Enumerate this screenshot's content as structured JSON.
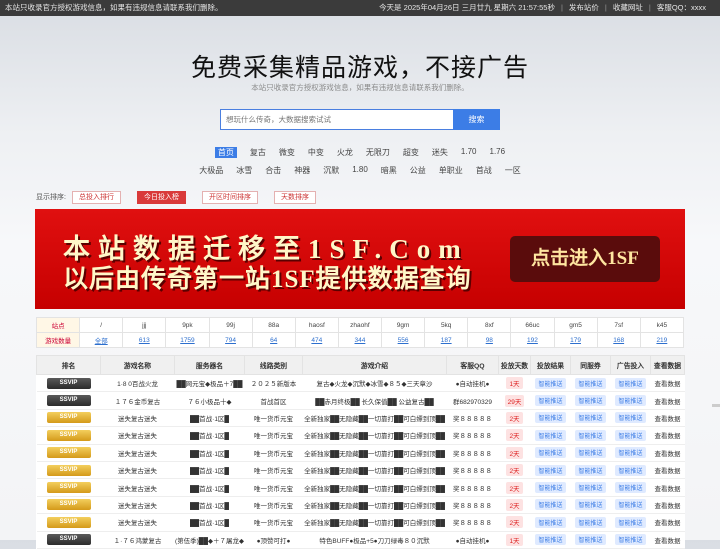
{
  "topbar": {
    "notice": "本站只收录官方授权游戏信息，如果有违规信息请联系我们删除。",
    "date": "今天是 2025年04月26日 三月廿九 星期六 21:57:55秒",
    "publish": "发布站价",
    "favorite": "收藏网址",
    "qq": "客服QQ：xxxx"
  },
  "hero": {
    "title": "免费采集精品游戏，不接广告",
    "subtitle": "本站只收录官方授权游戏信息，如果有违规信息请联系我们删除。"
  },
  "search": {
    "placeholder": "想玩什么传奇，大数据搜索试试",
    "button": "搜索"
  },
  "nav1": [
    "首页",
    "复古",
    "微变",
    "中变",
    "火龙",
    "无限刀",
    "超变",
    "迷失",
    "1.70",
    "1.76"
  ],
  "nav2": [
    "大极品",
    "冰雪",
    "合击",
    "神器",
    "沉默",
    "1.80",
    "暗黑",
    "公益",
    "单职业",
    "首战",
    "一区"
  ],
  "sort": {
    "label": "显示排序:",
    "buttons": [
      "总投入排行",
      "今日投入榜",
      "开区时间排序",
      "天数排序"
    ],
    "active": 1
  },
  "banner": {
    "line1": "本站数据迁移至1SF.Com",
    "line2": "以后由传奇第一站1SF提供数据查询",
    "cta": "点击进入1SF",
    "bg": "#d40000"
  },
  "stats": {
    "row1": [
      "站点",
      "/",
      "jjj",
      "9pk",
      "99j",
      "88a",
      "haosf",
      "zhaohf",
      "9gm",
      "5kq",
      "8xf",
      "66uc",
      "gm5",
      "7sf",
      "k45"
    ],
    "row2": [
      "游戏数量",
      "全部",
      "613",
      "1759",
      "794",
      "64",
      "474",
      "344",
      "556",
      "187",
      "98",
      "192",
      "179",
      "168",
      "219"
    ]
  },
  "table": {
    "headers": [
      "排名",
      "游戏名称",
      "服务器名",
      "线路类别",
      "游戏介绍",
      "客服QQ",
      "投放天数",
      "投放结果",
      "同服券",
      "广告投入",
      "查看数据"
    ],
    "rows": [
      {
        "rank": "SSVIP",
        "style": "dark",
        "name": "1·8 0百战火龙",
        "server": "██网元宝◆极品＋7██",
        "line": "２０２５新版本",
        "intro": "复古◆火龙◆沉默◆冰雪◆８５◆三天章沙",
        "qq": "●自动挂机●",
        "days": "1天",
        "r1": "智能推送",
        "r2": "智能推送",
        "r3": "智能推送",
        "view": "查看数据"
      },
      {
        "rank": "SSVIP",
        "style": "dark",
        "name": "１７６金币复古",
        "server": "７６小极品十◆",
        "line": "首战首区",
        "intro": "██赤月终极██ 长久保值██ 公益复古██",
        "qq": "群682970329",
        "days": "29天",
        "r1": "智能推送",
        "r2": "智能推送",
        "r3": "智能推送",
        "view": "查看数据"
      },
      {
        "rank": "SSVIP",
        "style": "gold",
        "name": "迷失复古迷失",
        "server": "██首战·1区█",
        "line": "唯一货币元宝",
        "intro": "全新独家██无隐藏██一切靠打██可白嫖到顶██",
        "qq": "奖８８８８８",
        "days": "2天",
        "r1": "智能推送",
        "r2": "智能推送",
        "r3": "智能推送",
        "view": "查看数据"
      },
      {
        "rank": "SSVIP",
        "style": "gold",
        "name": "迷失复古迷失",
        "server": "██首战·1区█",
        "line": "唯一货币元宝",
        "intro": "全新独家██无隐藏██一切靠打██可白嫖到顶██",
        "qq": "奖８８８８８",
        "days": "2天",
        "r1": "智能推送",
        "r2": "智能推送",
        "r3": "智能推送",
        "view": "查看数据"
      },
      {
        "rank": "SSVIP",
        "style": "gold",
        "name": "迷失复古迷失",
        "server": "██首战·1区█",
        "line": "唯一货币元宝",
        "intro": "全新独家██无隐藏██一切靠打██可白嫖到顶██",
        "qq": "奖８８８８８",
        "days": "2天",
        "r1": "智能推送",
        "r2": "智能推送",
        "r3": "智能推送",
        "view": "查看数据"
      },
      {
        "rank": "SSVIP",
        "style": "gold",
        "name": "迷失复古迷失",
        "server": "██首战·1区█",
        "line": "唯一货币元宝",
        "intro": "全新独家██无隐藏██一切靠打██可白嫖到顶██",
        "qq": "奖８８８８８",
        "days": "2天",
        "r1": "智能推送",
        "r2": "智能推送",
        "r3": "智能推送",
        "view": "查看数据"
      },
      {
        "rank": "SSVIP",
        "style": "gold",
        "name": "迷失复古迷失",
        "server": "██首战·1区█",
        "line": "唯一货币元宝",
        "intro": "全新独家██无隐藏██一切靠打██可白嫖到顶██",
        "qq": "奖８８８８８",
        "days": "2天",
        "r1": "智能推送",
        "r2": "智能推送",
        "r3": "智能推送",
        "view": "查看数据"
      },
      {
        "rank": "SSVIP",
        "style": "gold",
        "name": "迷失复古迷失",
        "server": "██首战·1区█",
        "line": "唯一货币元宝",
        "intro": "全新独家██无隐藏██一切靠打██可白嫖到顶██",
        "qq": "奖８８８８８",
        "days": "2天",
        "r1": "智能推送",
        "r2": "智能推送",
        "r3": "智能推送",
        "view": "查看数据"
      },
      {
        "rank": "SSVIP",
        "style": "gold",
        "name": "迷失复古迷失",
        "server": "██首战·1区█",
        "line": "唯一货币元宝",
        "intro": "全新独家██无隐藏██一切靠打██可白嫖到顶██",
        "qq": "奖８８８８８",
        "days": "2天",
        "r1": "智能推送",
        "r2": "智能推送",
        "r3": "智能推送",
        "view": "查看数据"
      },
      {
        "rank": "SSVIP",
        "style": "dark",
        "name": "１·７６鸿蒙复古",
        "server": "(第伍季)██◆＋７屠龙◆",
        "line": "●顶赞可打●",
        "intro": "特色BUFF●极品+5●刀刀绿毒８０沉默",
        "qq": "●自动挂机●",
        "days": "1天",
        "r1": "智能推送",
        "r2": "智能推送",
        "r3": "智能推送",
        "view": "查看数据"
      }
    ]
  }
}
